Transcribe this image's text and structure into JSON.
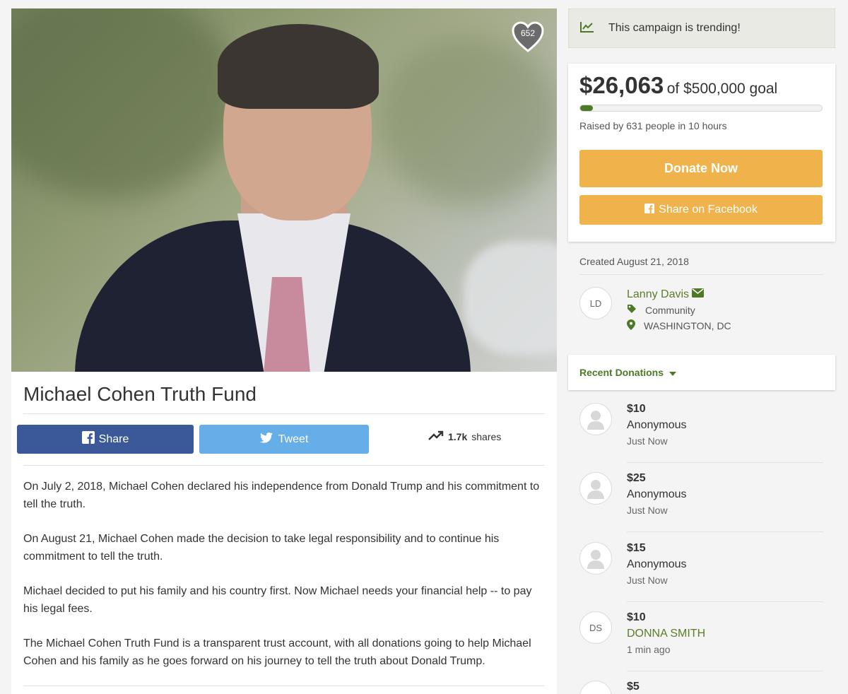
{
  "hero": {
    "heart_count": "652"
  },
  "campaign": {
    "title": "Michael Cohen Truth Fund",
    "share_label": "Share",
    "tweet_label": "Tweet",
    "shares_count": "1.7k",
    "shares_label": "shares",
    "story": [
      "On July 2, 2018, Michael Cohen declared his independence from Donald Trump and his commitment to tell the truth.",
      "On August 21, Michael Cohen made the decision to take legal responsibility and to continue his commitment to tell the truth.",
      "Michael decided to put his family and his country first.  Now Michael needs your financial help -- to pay his legal fees.",
      "The Michael Cohen Truth Fund is a transparent trust account, with all donations going to help Michael Cohen and his family as he goes forward on his journey to tell the truth about Donald Trump."
    ]
  },
  "sidebar": {
    "trending_text": "This campaign is trending!",
    "raised_amount": "$26,063",
    "goal_text": "of $500,000 goal",
    "progress_fraction": 0.052,
    "raised_by": "Raised by 631 people in 10 hours",
    "donate_label": "Donate Now",
    "share_fb_label": "Share on Facebook",
    "created": "Created August 21, 2018",
    "organizer": {
      "initials": "LD",
      "name": "Lanny Davis",
      "category": "Community",
      "location": "WASHINGTON, DC"
    },
    "recent_label": "Recent Donations",
    "donations": [
      {
        "amount": "$10",
        "name": "Anonymous",
        "time": "Just Now",
        "initials": ""
      },
      {
        "amount": "$25",
        "name": "Anonymous",
        "time": "Just Now",
        "initials": ""
      },
      {
        "amount": "$15",
        "name": "Anonymous",
        "time": "Just Now",
        "initials": ""
      },
      {
        "amount": "$10",
        "name": "DONNA SMITH",
        "time": "1 min ago",
        "initials": "DS"
      },
      {
        "amount": "$5",
        "name": "",
        "time": "",
        "initials": ""
      }
    ]
  },
  "colors": {
    "accent_green": "#4d7a27",
    "donate_orange": "#f0b34b",
    "facebook_blue": "#3b5998",
    "twitter_blue": "#65aee7"
  }
}
